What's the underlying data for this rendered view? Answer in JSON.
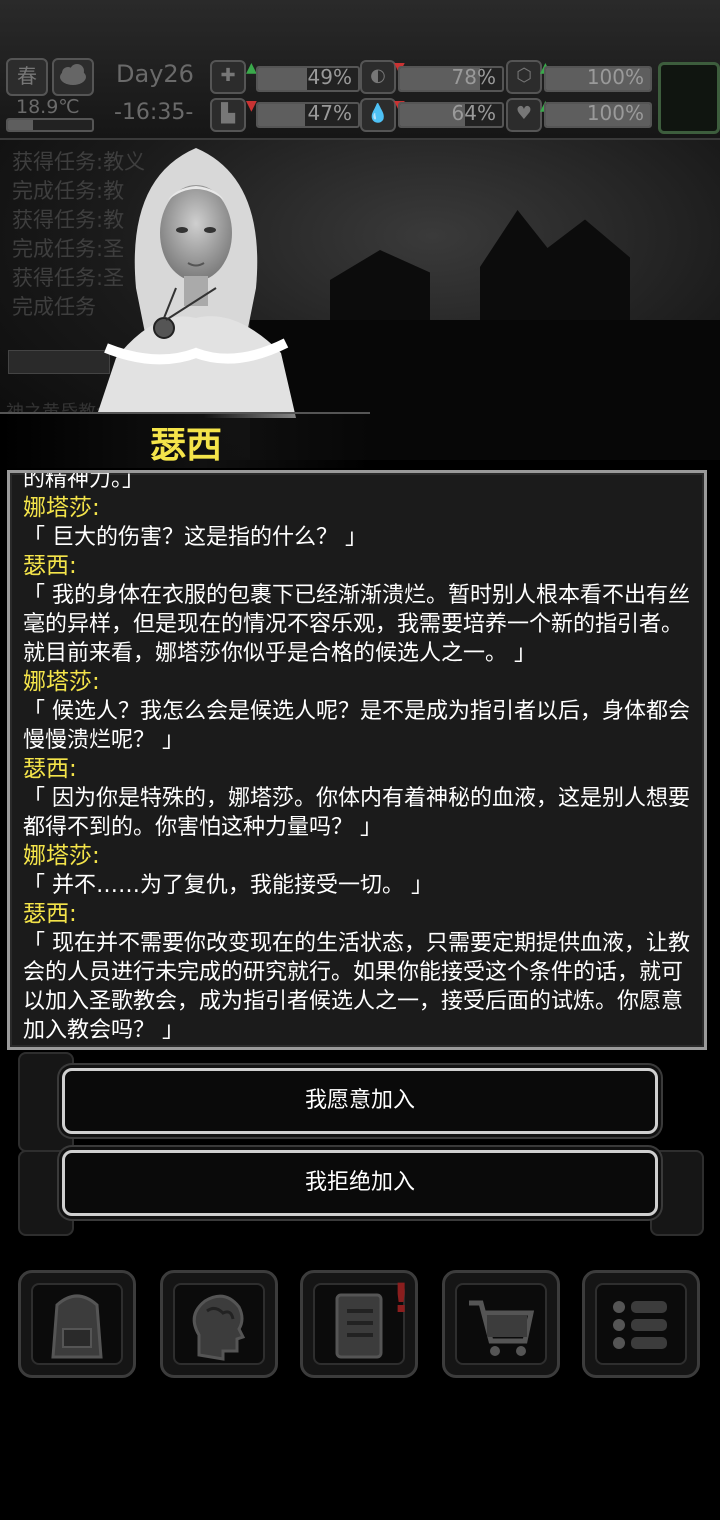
{
  "status": {
    "season": "春",
    "temperature": "18.9℃",
    "day": "Day26",
    "time": "-16:35-",
    "stats": [
      {
        "name": "health",
        "value": "49%",
        "fill": 49,
        "trend": "up"
      },
      {
        "name": "hunger",
        "value": "78%",
        "fill": 78,
        "trend": "down"
      },
      {
        "name": "defense",
        "value": "100%",
        "fill": 100,
        "trend": "up"
      },
      {
        "name": "stamina",
        "value": "47%",
        "fill": 47,
        "trend": "down"
      },
      {
        "name": "thirst",
        "value": "64%",
        "fill": 64,
        "trend": "down"
      },
      {
        "name": "mood",
        "value": "100%",
        "fill": 100,
        "trend": "up"
      }
    ]
  },
  "log": [
    "获得任务:教义",
    "完成任务:教",
    "获得任务:教",
    "完成任务:圣",
    "获得任务:圣",
    "完成任务"
  ],
  "location_hint": "神之黄昏教会总部",
  "speaker_name": "瑟西",
  "dialog": {
    "cutoff_line": "的精神力。」",
    "entries": [
      {
        "speaker": "娜塔莎:",
        "text": "「 巨大的伤害？这是指的什么？ 」"
      },
      {
        "speaker": "瑟西:",
        "text": "「 我的身体在衣服的包裹下已经渐渐溃烂。暂时别人根本看不出有丝毫的异样，但是现在的情况不容乐观，我需要培养一个新的指引者。就目前来看，娜塔莎你似乎是合格的候选人之一。 」"
      },
      {
        "speaker": "娜塔莎:",
        "text": "「 候选人？我怎么会是候选人呢？是不是成为指引者以后，身体都会慢慢溃烂呢？ 」"
      },
      {
        "speaker": "瑟西:",
        "text": "「 因为你是特殊的，娜塔莎。你体内有着神秘的血液，这是别人想要都得不到的。你害怕这种力量吗？ 」"
      },
      {
        "speaker": "娜塔莎:",
        "text": "「 并不……为了复仇，我能接受一切。 」"
      },
      {
        "speaker": "瑟西:",
        "text": "「 现在并不需要你改变现在的生活状态，只需要定期提供血液，让教会的人员进行未完成的研究就行。如果你能接受这个条件的话，就可以加入圣歌教会，成为指引者候选人之一，接受后面的试炼。你愿意加入教会吗？ 」"
      }
    ]
  },
  "choices": [
    "我愿意加入",
    "我拒绝加入"
  ],
  "nav": [
    "backpack-icon",
    "brain-icon",
    "notes-icon",
    "shopping-cart-icon",
    "menu-icon"
  ],
  "notes_badge": "!"
}
